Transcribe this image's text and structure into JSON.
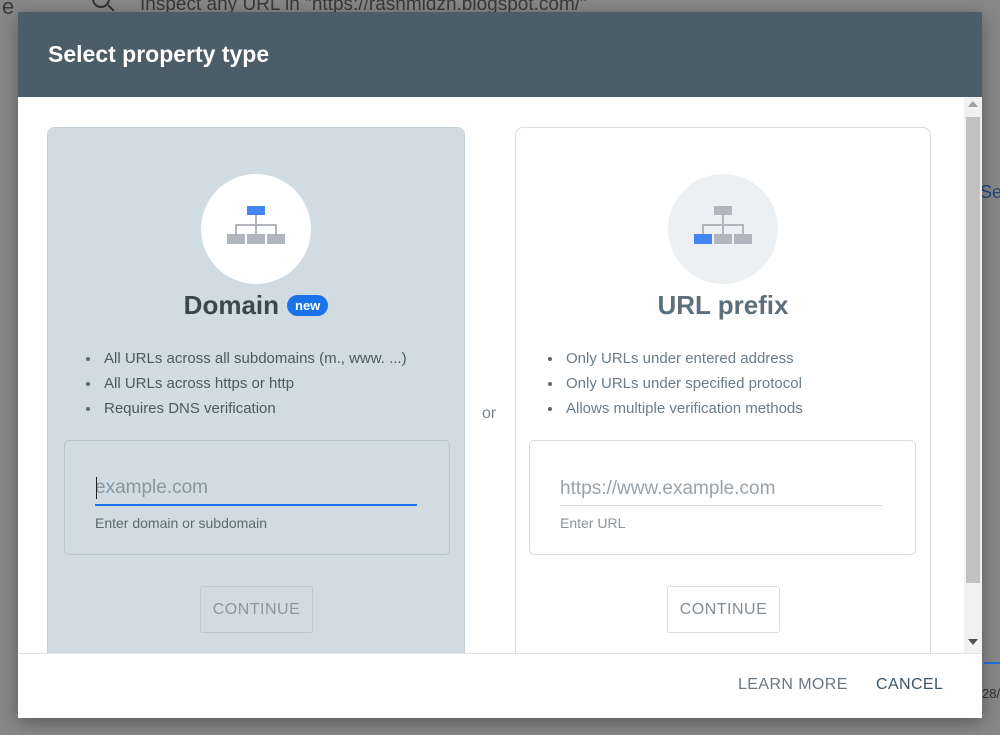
{
  "background": {
    "search_text": "Inspect any URL in \"https://rashmidzh.blogspot.com/\"",
    "left_letter": "e",
    "right_text": "Se",
    "right_number": "28/"
  },
  "dialog": {
    "title": "Select property type",
    "separator": "or"
  },
  "domain": {
    "title": "Domain",
    "badge": "new",
    "features": [
      "All URLs across all subdomains (m., www. ...)",
      "All URLs across https or http",
      "Requires DNS verification"
    ],
    "input_placeholder": "example.com",
    "helper": "Enter domain or subdomain",
    "continue_label": "CONTINUE"
  },
  "url_prefix": {
    "title": "URL prefix",
    "features": [
      "Only URLs under entered address",
      "Only URLs under specified protocol",
      "Allows multiple verification methods"
    ],
    "input_placeholder": "https://www.example.com",
    "helper": "Enter URL",
    "continue_label": "CONTINUE"
  },
  "footer": {
    "learn_more": "LEARN MORE",
    "cancel": "CANCEL"
  },
  "colors": {
    "header": "#4b5d68",
    "accent": "#1a73e8",
    "domain_card": "#d0dbe2"
  }
}
